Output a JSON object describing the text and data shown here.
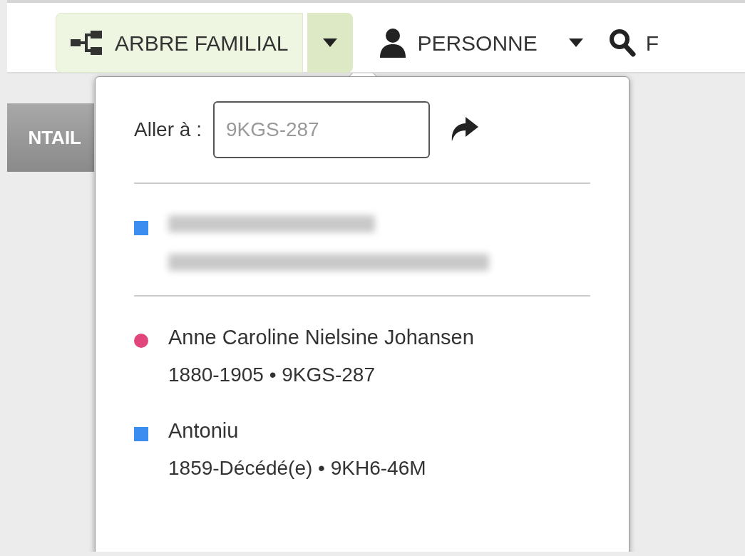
{
  "nav": {
    "tree_button": {
      "label": "ARBRE FAMILIAL",
      "selected": true
    },
    "person_button": {
      "label": "PERSONNE"
    },
    "search_button": {
      "label": "F"
    }
  },
  "side_tab": {
    "label": "NTAIL"
  },
  "dropdown": {
    "goto_label": "Aller à :",
    "goto_field": {
      "placeholder": "9KGS-287"
    },
    "entries": [
      {
        "kind": "male",
        "color": "#3b8ef0",
        "redacted": true
      },
      {
        "kind": "female",
        "color": "#e0457b",
        "name": "Anne Caroline Nielsine Johansen",
        "details": "1880-1905 • 9KGS-287",
        "redacted": false
      },
      {
        "kind": "male",
        "color": "#3b8ef0",
        "name": "Antoniu",
        "details": "1859-Décédé(e) • 9KH6-46M",
        "redacted": false
      }
    ]
  }
}
